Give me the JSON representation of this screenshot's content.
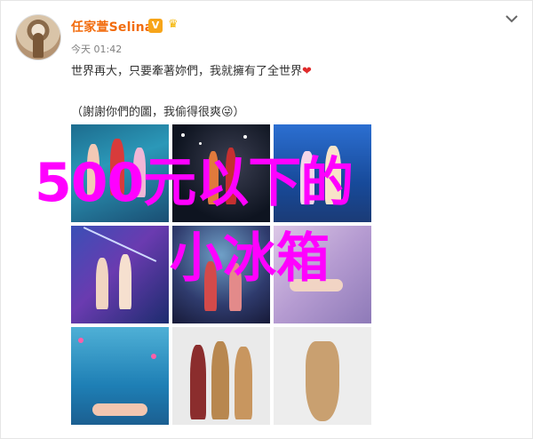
{
  "post": {
    "author": "任家萱Selina",
    "vip_badge": "V",
    "timestamp": "今天 01:42",
    "text_line1": "世界再大，只要牽著妳們，我就擁有了全世界",
    "heart": "❤",
    "text_line2": "（謝謝你們的圖，我偷得很爽😜）"
  },
  "icons": {
    "menu": "chevron-down-icon",
    "badge": "vip-badge-icon",
    "crown": "crown-icon"
  },
  "overlay": {
    "line1": "500元以下的",
    "line2": "小冰箱"
  },
  "colors": {
    "author": "#f26c0d",
    "overlay": "#ff00ff",
    "heart": "#e02b2b"
  },
  "images": [
    "stage-photo-1",
    "stage-photo-2",
    "stage-photo-3",
    "stage-photo-4",
    "stage-photo-5",
    "stage-photo-6",
    "stage-photo-7",
    "studio-photo-8",
    "studio-photo-9"
  ]
}
